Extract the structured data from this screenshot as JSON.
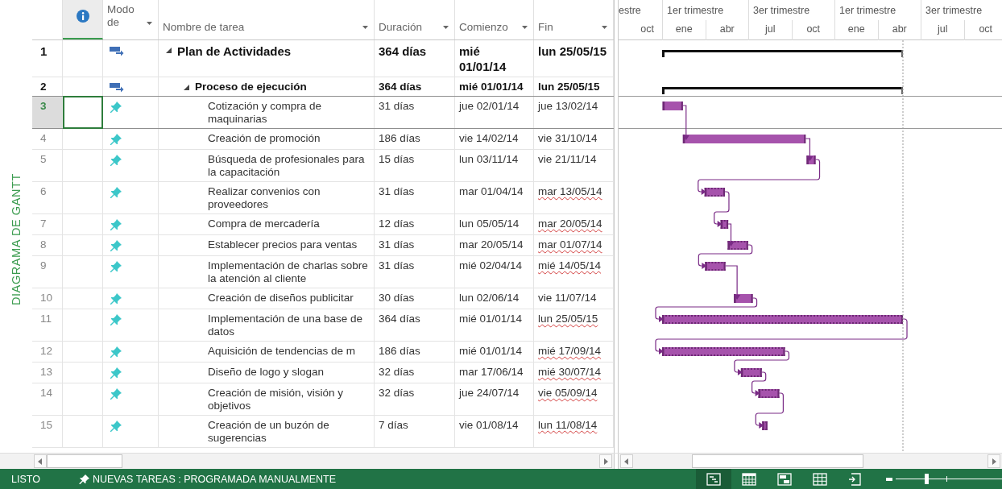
{
  "side_label": "DIAGRAMA DE GANTT",
  "columns": [
    {
      "kind": "info"
    },
    {
      "kind": "mode",
      "label": "Modo de",
      "filter": true
    },
    {
      "kind": "name",
      "label": "Nombre de tarea",
      "filter": true
    },
    {
      "kind": "duration",
      "label": "Duración",
      "filter": true
    },
    {
      "kind": "start",
      "label": "Comienzo",
      "filter": true
    },
    {
      "kind": "finish",
      "label": "Fin",
      "filter": true
    }
  ],
  "timescale": {
    "top": [
      "estre",
      "1er trimestre",
      "3er trimestre",
      "1er trimestre",
      "3er trimestre"
    ],
    "bottom": [
      "oct",
      "ene",
      "abr",
      "jul",
      "oct",
      "ene",
      "abr",
      "jul",
      "oct"
    ]
  },
  "tasks": [
    {
      "row": "1",
      "kind": "summary",
      "name": "Plan de Actividades",
      "duration": "364 días",
      "start": "mié 01/01/14",
      "finish": "lun 25/05/15",
      "finish_warning": false,
      "selected": false,
      "expanded": true,
      "children": [
        {
          "row": "2",
          "kind": "summary",
          "name": "Proceso de ejecución",
          "duration": "364 días",
          "start": "mié 01/01/14",
          "finish": "lun 25/05/15",
          "finish_warning": false,
          "selected": false,
          "expanded": true,
          "children": [
            {
              "row": "3",
              "kind": "manual",
              "name": "Cotización y compra de maquinarias",
              "duration": "31 días",
              "start": "jue 02/01/14",
              "finish": "jue 13/02/14",
              "finish_warning": false,
              "selected": true
            },
            {
              "row": "4",
              "kind": "manual",
              "name": "Creación de promoción",
              "duration": "186 días",
              "start": "vie 14/02/14",
              "finish": "vie 31/10/14",
              "finish_warning": false,
              "selected": false
            },
            {
              "row": "5",
              "kind": "manual",
              "name": "Búsqueda de profesionales para la capacitación",
              "duration": "15 días",
              "start": "lun 03/11/14",
              "finish": "vie 21/11/14",
              "finish_warning": false,
              "selected": false
            },
            {
              "row": "6",
              "kind": "manual",
              "name": "Realizar convenios con proveedores",
              "duration": "31 días",
              "start": "mar 01/04/14",
              "finish": "mar 13/05/14",
              "finish_warning": true,
              "selected": false
            },
            {
              "row": "7",
              "kind": "manual",
              "name": "Compra de mercadería",
              "duration": "12 días",
              "start": "lun 05/05/14",
              "finish": "mar 20/05/14",
              "finish_warning": true,
              "selected": false
            },
            {
              "row": "8",
              "kind": "manual",
              "name": "Establecer precios para ventas",
              "duration": "31 días",
              "start": "mar 20/05/14",
              "finish": "mar 01/07/14",
              "finish_warning": true,
              "selected": false
            },
            {
              "row": "9",
              "kind": "manual",
              "name": "Implementación de charlas sobre la atención al cliente",
              "duration": "31 días",
              "start": "mié 02/04/14",
              "finish": "mié 14/05/14",
              "finish_warning": true,
              "selected": false
            },
            {
              "row": "10",
              "kind": "manual",
              "name": "Creación de diseños publicitar",
              "duration": "30 días",
              "start": "lun 02/06/14",
              "finish": "vie 11/07/14",
              "finish_warning": false,
              "selected": false
            },
            {
              "row": "11",
              "kind": "manual",
              "name": "Implementación de una base de datos",
              "duration": "364 días",
              "start": "mié 01/01/14",
              "finish": "lun 25/05/15",
              "finish_warning": true,
              "selected": false
            },
            {
              "row": "12",
              "kind": "manual",
              "name": "Aquisición de tendencias de m",
              "duration": "186 días",
              "start": "mié 01/01/14",
              "finish": "mié 17/09/14",
              "finish_warning": true,
              "selected": false
            },
            {
              "row": "13",
              "kind": "manual",
              "name": "Diseño de logo y slogan",
              "duration": "32 días",
              "start": "mar 17/06/14",
              "finish": "mié 30/07/14",
              "finish_warning": true,
              "selected": false
            },
            {
              "row": "14",
              "kind": "manual",
              "name": "Creación de misión, visión y objetivos",
              "duration": "32 días",
              "start": "jue 24/07/14",
              "finish": "vie 05/09/14",
              "finish_warning": true,
              "selected": false
            },
            {
              "row": "15",
              "kind": "manual",
              "name": "Creación de un buzón de sugerencias",
              "duration": "7 días",
              "start": "vie 01/08/14",
              "finish": "lun 11/08/14",
              "finish_warning": true,
              "selected": false
            }
          ]
        }
      ]
    }
  ],
  "status_bar": {
    "mode": "LISTO",
    "new_tasks": "NUEVAS TAREAS : PROGRAMADA MANUALMENTE",
    "views": [
      {
        "kind": "gantt",
        "selected": true
      },
      {
        "kind": "usage",
        "selected": false
      },
      {
        "kind": "planner",
        "selected": false
      },
      {
        "kind": "sheet",
        "selected": false
      },
      {
        "kind": "report",
        "selected": false
      }
    ],
    "zoom": {
      "level": 0.29
    }
  }
}
